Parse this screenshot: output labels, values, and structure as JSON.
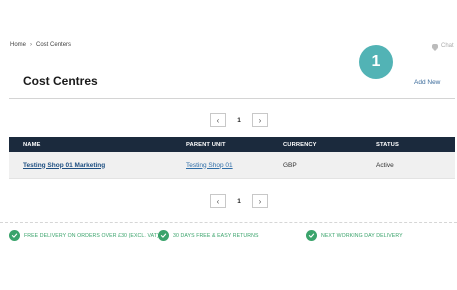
{
  "breadcrumb": {
    "home": "Home",
    "separator": "›",
    "current": "Cost Centers"
  },
  "chat": {
    "label": "Chat",
    "icon": "chat-bubble-icon"
  },
  "step_badge": "1",
  "page": {
    "title": "Cost Centres",
    "add_new": "Add New"
  },
  "pagination": {
    "prev_icon": "‹",
    "page": "1",
    "next_icon": "›"
  },
  "table": {
    "headers": [
      "NAME",
      "PARENT UNIT",
      "CURRENCY",
      "STATUS"
    ],
    "rows": [
      {
        "name": "Testing Shop 01 Marketing",
        "parent": "Testing Shop 01",
        "currency": "GBP",
        "status": "Active"
      }
    ]
  },
  "usps": [
    "FREE DELIVERY ON ORDERS OVER £30 (EXCL. VAT)",
    "30 DAYS FREE & EASY RETURNS",
    "NEXT WORKING DAY DELIVERY"
  ],
  "colors": {
    "accent": "#52b3b5",
    "header_bg": "#1b2a3d",
    "link": "#1e4f82",
    "usp_green": "#3aa36b"
  }
}
